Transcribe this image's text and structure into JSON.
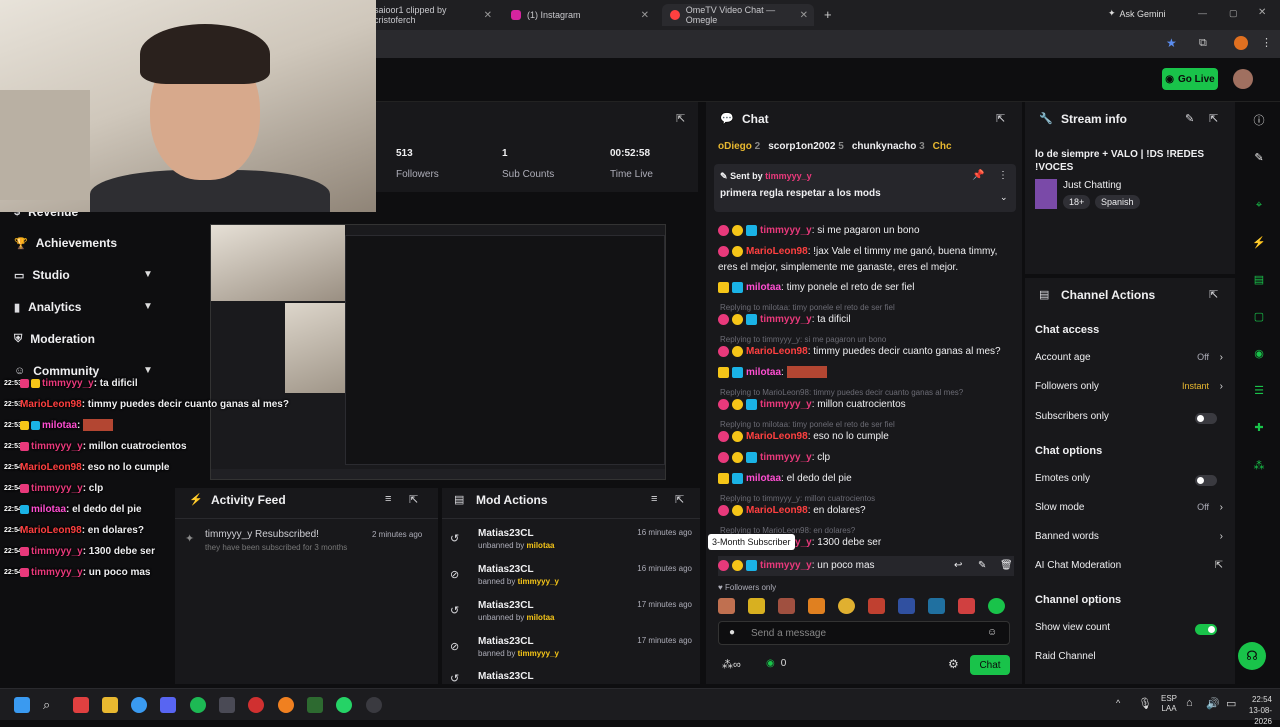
{
  "browser": {
    "tabs": [
      {
        "label": "saioor1 clipped by cristoferch"
      },
      {
        "label": "(1) Instagram"
      },
      {
        "label": "OmeTV Video Chat — Omegle"
      }
    ],
    "new_tab": "+",
    "ask_gemini": "Ask Gemini"
  },
  "appbar": {
    "go_live": "Go Live"
  },
  "sidebar": {
    "items": [
      {
        "label": "Revenue"
      },
      {
        "label": "Achievements"
      },
      {
        "label": "Studio"
      },
      {
        "label": "Analytics"
      },
      {
        "label": "Moderation"
      },
      {
        "label": "Community"
      }
    ]
  },
  "stats": [
    {
      "value": "513",
      "label": "Followers"
    },
    {
      "value": "1",
      "label": "Sub Counts"
    },
    {
      "value": "00:52:58",
      "label": "Time Live"
    }
  ],
  "overlay_chat": [
    {
      "time": "22:53",
      "user": "timmyyy_y",
      "user_color": "#e8397b",
      "text": ": ta dificil"
    },
    {
      "time": "22:53",
      "user": "MarioLeon98",
      "user_color": "#ff4040",
      "text": ": timmy puedes decir cuanto ganas al mes?"
    },
    {
      "time": "22:53",
      "user": "milotaa",
      "user_color": "#ff4fd2",
      "text": ":"
    },
    {
      "time": "22:53",
      "user": "timmyyy_y",
      "user_color": "#e8397b",
      "text": ": millon cuatrocientos"
    },
    {
      "time": "22:54",
      "user": "MarioLeon98",
      "user_color": "#ff4040",
      "text": ": eso no lo cumple"
    },
    {
      "time": "22:54",
      "user": "timmyyy_y",
      "user_color": "#e8397b",
      "text": ": clp"
    },
    {
      "time": "22:54",
      "user": "milotaa",
      "user_color": "#ff4fd2",
      "text": ": el dedo del pie"
    },
    {
      "time": "22:54",
      "user": "MarioLeon98",
      "user_color": "#ff4040",
      "text": ": en dolares?"
    },
    {
      "time": "22:54",
      "user": "timmyyy_y",
      "user_color": "#e8397b",
      "text": ": 1300 debe ser"
    },
    {
      "time": "22:54",
      "user": "timmyyy_y",
      "user_color": "#e8397b",
      "text": ": un poco mas"
    }
  ],
  "activity_feed": {
    "title": "Activity Feed",
    "items": [
      {
        "title": "timmyyy_y Resubscribed!",
        "subtitle": "they have been subscribed for 3 months",
        "time": "2 minutes ago"
      }
    ]
  },
  "mod_actions": {
    "title": "Mod Actions",
    "rows": [
      {
        "user": "Matias23CL",
        "action": "unbanned by",
        "by": "milotaa",
        "time": "16 minutes ago"
      },
      {
        "user": "Matias23CL",
        "action": "banned by",
        "by": "timmyyy_y",
        "time": "16 minutes ago"
      },
      {
        "user": "Matias23CL",
        "action": "unbanned by",
        "by": "milotaa",
        "time": "17 minutes ago"
      },
      {
        "user": "Matias23CL",
        "action": "banned by",
        "by": "timmyyy_y",
        "time": "17 minutes ago"
      },
      {
        "user": "Matias23CL",
        "action": "",
        "by": "",
        "time": "17 minutes ago"
      }
    ]
  },
  "chat": {
    "title": "Chat",
    "top_chatters": [
      {
        "name": "oDiego",
        "count": "2"
      },
      {
        "name": "scorp1on2002",
        "count": "5"
      },
      {
        "name": "chunkynacho",
        "count": "3"
      },
      {
        "name": "Chc",
        "count": ""
      }
    ],
    "pinned": {
      "sent_by_label": "Sent by",
      "user": "timmyyy_y",
      "message": "primera regla respetar a los mods"
    },
    "messages": [
      {
        "user": "timmyyy_y",
        "color": "#e8397b",
        "text": ": si me pagaron un bono",
        "reply": "",
        "link": false
      },
      {
        "user": "MarioLeon98",
        "color": "#ff4040",
        "text": ": !jax Vale el timmy me ganó, buena timmy, eres el mejor, simplemente me ganaste, eres el mejor.",
        "reply": "",
        "link": false
      },
      {
        "user": "milotaa",
        "color": "#ff4fd2",
        "text": ": timy ponele el reto de ser fiel",
        "reply": "",
        "link": false
      },
      {
        "user": "timmyyy_y",
        "color": "#e8397b",
        "text": ": ta dificil",
        "reply": "Replying to milotaa: timy ponele el reto de ser fiel",
        "link": false
      },
      {
        "user": "MarioLeon98",
        "color": "#ff4040",
        "text": ": timmy puedes decir cuanto ganas al mes?",
        "reply": "Replying to timmyyy_y: si me pagaron un bono",
        "link": false
      },
      {
        "user": "milotaa",
        "color": "#ff4fd2",
        "text": ":",
        "reply": "",
        "link": true
      },
      {
        "user": "timmyyy_y",
        "color": "#e8397b",
        "text": ": millon cuatrocientos",
        "reply": "Replying to MarioLeon98: timmy puedes decir cuanto ganas al mes?",
        "link": false
      },
      {
        "user": "MarioLeon98",
        "color": "#ff4040",
        "text": ": eso no lo cumple",
        "reply": "Replying to milotaa: timy ponele el reto de ser fiel",
        "link": false
      },
      {
        "user": "timmyyy_y",
        "color": "#e8397b",
        "text": ": clp",
        "reply": "",
        "link": false
      },
      {
        "user": "milotaa",
        "color": "#ff4fd2",
        "text": ": el dedo del pie",
        "reply": "",
        "link": false
      },
      {
        "user": "MarioLeon98",
        "color": "#ff4040",
        "text": ": en dolares?",
        "reply": "Replying to timmyyy_y: millon cuatrocientos",
        "link": false
      },
      {
        "user": "timmyyy_y",
        "color": "#e8397b",
        "text": ": 1300 debe ser",
        "reply": "Replying to MarioLeon98: en dolares?",
        "link": false
      },
      {
        "user": "timmyyy_y",
        "color": "#e8397b",
        "text": ": un poco mas",
        "reply": "",
        "link": false
      }
    ],
    "tooltip": "3-Month Subscriber",
    "followers_only": "Followers only",
    "input_placeholder": "Send a message",
    "viewer_count": "0",
    "send_button": "Chat"
  },
  "stream_info": {
    "title": "Stream info",
    "stream_title": "lo de siempre + VALO | !DS !REDES !VOCES",
    "category": "Just Chatting",
    "tags": [
      "18+",
      "Spanish"
    ]
  },
  "channel_actions": {
    "title": "Channel Actions",
    "chat_access_header": "Chat access",
    "account_age": {
      "label": "Account age",
      "value": "Off"
    },
    "followers_only": {
      "label": "Followers only",
      "value": "Instant"
    },
    "subscribers_only": {
      "label": "Subscribers only"
    },
    "chat_options_header": "Chat options",
    "emotes_only": {
      "label": "Emotes only"
    },
    "slow_mode": {
      "label": "Slow mode",
      "value": "Off"
    },
    "banned_words": {
      "label": "Banned words"
    },
    "ai_moderation": {
      "label": "AI Chat Moderation"
    },
    "channel_options_header": "Channel options",
    "show_view_count": {
      "label": "Show view count"
    },
    "raid_channel": {
      "label": "Raid Channel"
    }
  },
  "taskbar": {
    "lang": "ESP",
    "lang2": "LAA",
    "time": "22:54",
    "date": "13-08-2026"
  },
  "colors": {
    "accent": "#19c34a",
    "timmy": "#e8397b",
    "mario": "#ff4040",
    "milotaa": "#ff4fd2"
  }
}
